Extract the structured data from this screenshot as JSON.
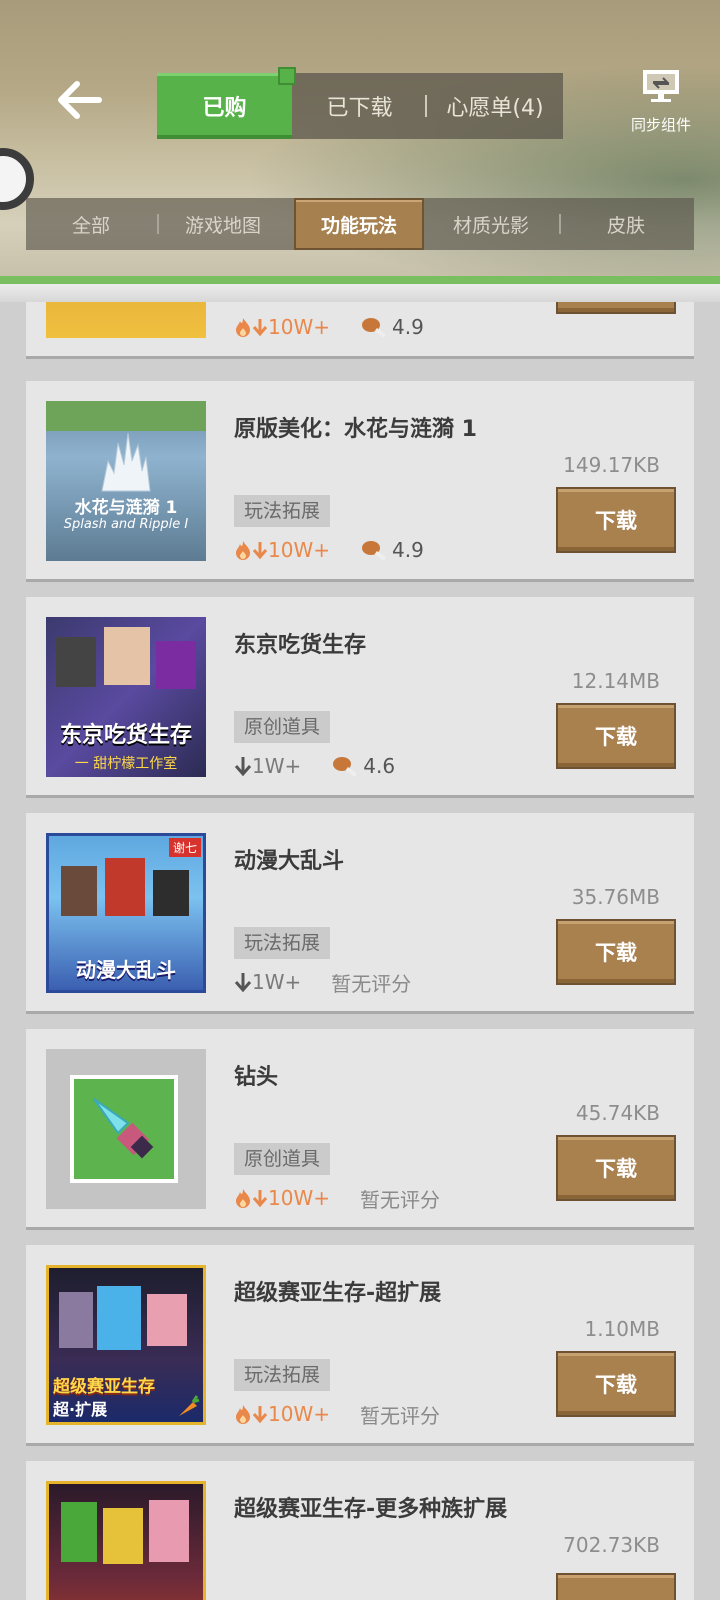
{
  "header": {
    "back_icon": "arrow-left-icon",
    "segments": [
      {
        "label": "已购",
        "active": true
      },
      {
        "label": "已下载",
        "active": false
      },
      {
        "label": "心愿单(4)",
        "active": false
      }
    ],
    "sync_label": "同步组件",
    "sync_icon": "sync-monitor-icon"
  },
  "tabs": [
    {
      "label": "全部"
    },
    {
      "label": "游戏地图"
    },
    {
      "label": "功能玩法",
      "active": true
    },
    {
      "label": "材质光影"
    },
    {
      "label": "皮肤"
    }
  ],
  "list": {
    "partial_item": {
      "downloads": "10W+",
      "rating": "4.9"
    },
    "items": [
      {
        "title": "原版美化：水花与涟漪 1",
        "size": "149.17KB",
        "tag": "玩法拓展",
        "hot": true,
        "downloads": "10W+",
        "rating": "4.9",
        "button": "下载",
        "thumb_text_1": "水花与涟漪 1",
        "thumb_text_2": "Splash and Ripple I"
      },
      {
        "title": "东京吃货生存",
        "size": "12.14MB",
        "tag": "原创道具",
        "hot": false,
        "downloads": "1W+",
        "rating": "4.6",
        "button": "下载",
        "thumb_text_1": "东京吃货生存",
        "thumb_text_2": "一 甜柠檬工作室"
      },
      {
        "title": "动漫大乱斗",
        "size": "35.76MB",
        "tag": "玩法拓展",
        "hot": false,
        "downloads": "1W+",
        "rating_text": "暂无评分",
        "button": "下载",
        "thumb_text_1": "动漫大乱斗",
        "thumb_badge": "谢七"
      },
      {
        "title": "钻头",
        "size": "45.74KB",
        "tag": "原创道具",
        "hot": true,
        "downloads": "10W+",
        "rating_text": "暂无评分",
        "button": "下载"
      },
      {
        "title": "超级赛亚生存-超扩展",
        "size": "1.10MB",
        "tag": "玩法拓展",
        "hot": true,
        "downloads": "10W+",
        "rating_text": "暂无评分",
        "button": "下载",
        "thumb_text_1": "超级赛亚生存",
        "thumb_text_2": "超·扩展"
      },
      {
        "title": "超级赛亚生存-更多种族扩展",
        "size": "702.73KB"
      }
    ]
  },
  "colors": {
    "accent_green": "#58b24a",
    "button_brown": "#a9814f",
    "hot_orange": "#e9884a"
  }
}
